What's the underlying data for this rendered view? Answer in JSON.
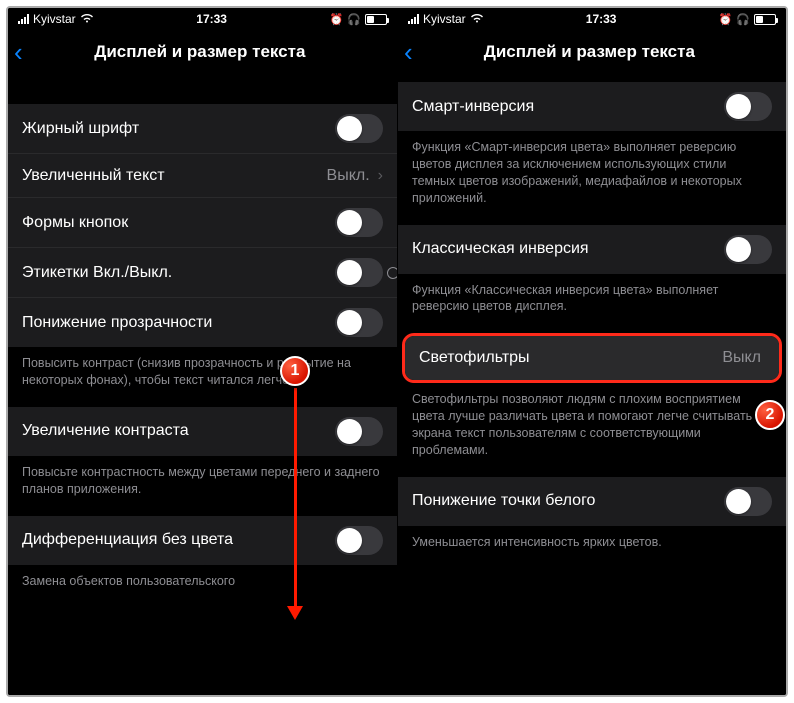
{
  "status": {
    "carrier": "Kyivstar",
    "time": "17:33"
  },
  "nav": {
    "title": "Дисплей и размер текста"
  },
  "left": {
    "rows": {
      "bold_text": "Жирный шрифт",
      "larger_text": "Увеличенный текст",
      "larger_text_value": "Выкл.",
      "button_shapes": "Формы кнопок",
      "on_off_labels": "Этикетки Вкл./Выкл.",
      "reduce_transparency": "Понижение прозрачности",
      "reduce_transparency_footer": "Повысить контраст (снизив прозрачность и размытие на некоторых фонах), чтобы текст читался легче.",
      "increase_contrast": "Увеличение контраста",
      "increase_contrast_footer": "Повысьте контрастность между цветами переднего и заднего планов приложения.",
      "diff_without_color": "Дифференциация без цвета",
      "diff_footer": "Замена объектов пользовательского"
    }
  },
  "right": {
    "rows": {
      "smart_invert": "Смарт-инверсия",
      "smart_invert_footer": "Функция «Смарт-инверсия цвета» выполняет реверсию цветов дисплея за исключением использующих стили темных цветов изображений, медиафайлов и некоторых приложений.",
      "classic_invert": "Классическая инверсия",
      "classic_invert_footer": "Функция «Классическая инверсия цвета» выполняет реверсию цветов дисплея.",
      "color_filters": "Светофильтры",
      "color_filters_value": "Выкл",
      "color_filters_footer": "Светофильтры позволяют людям с плохим восприятием цвета лучше различать цвета и помогают легче считывать с экрана текст пользователям с соответствующими проблемами.",
      "reduce_white_point": "Понижение точки белого",
      "reduce_white_point_footer": "Уменьшается интенсивность ярких цветов."
    }
  },
  "markers": {
    "one": "1",
    "two": "2"
  }
}
